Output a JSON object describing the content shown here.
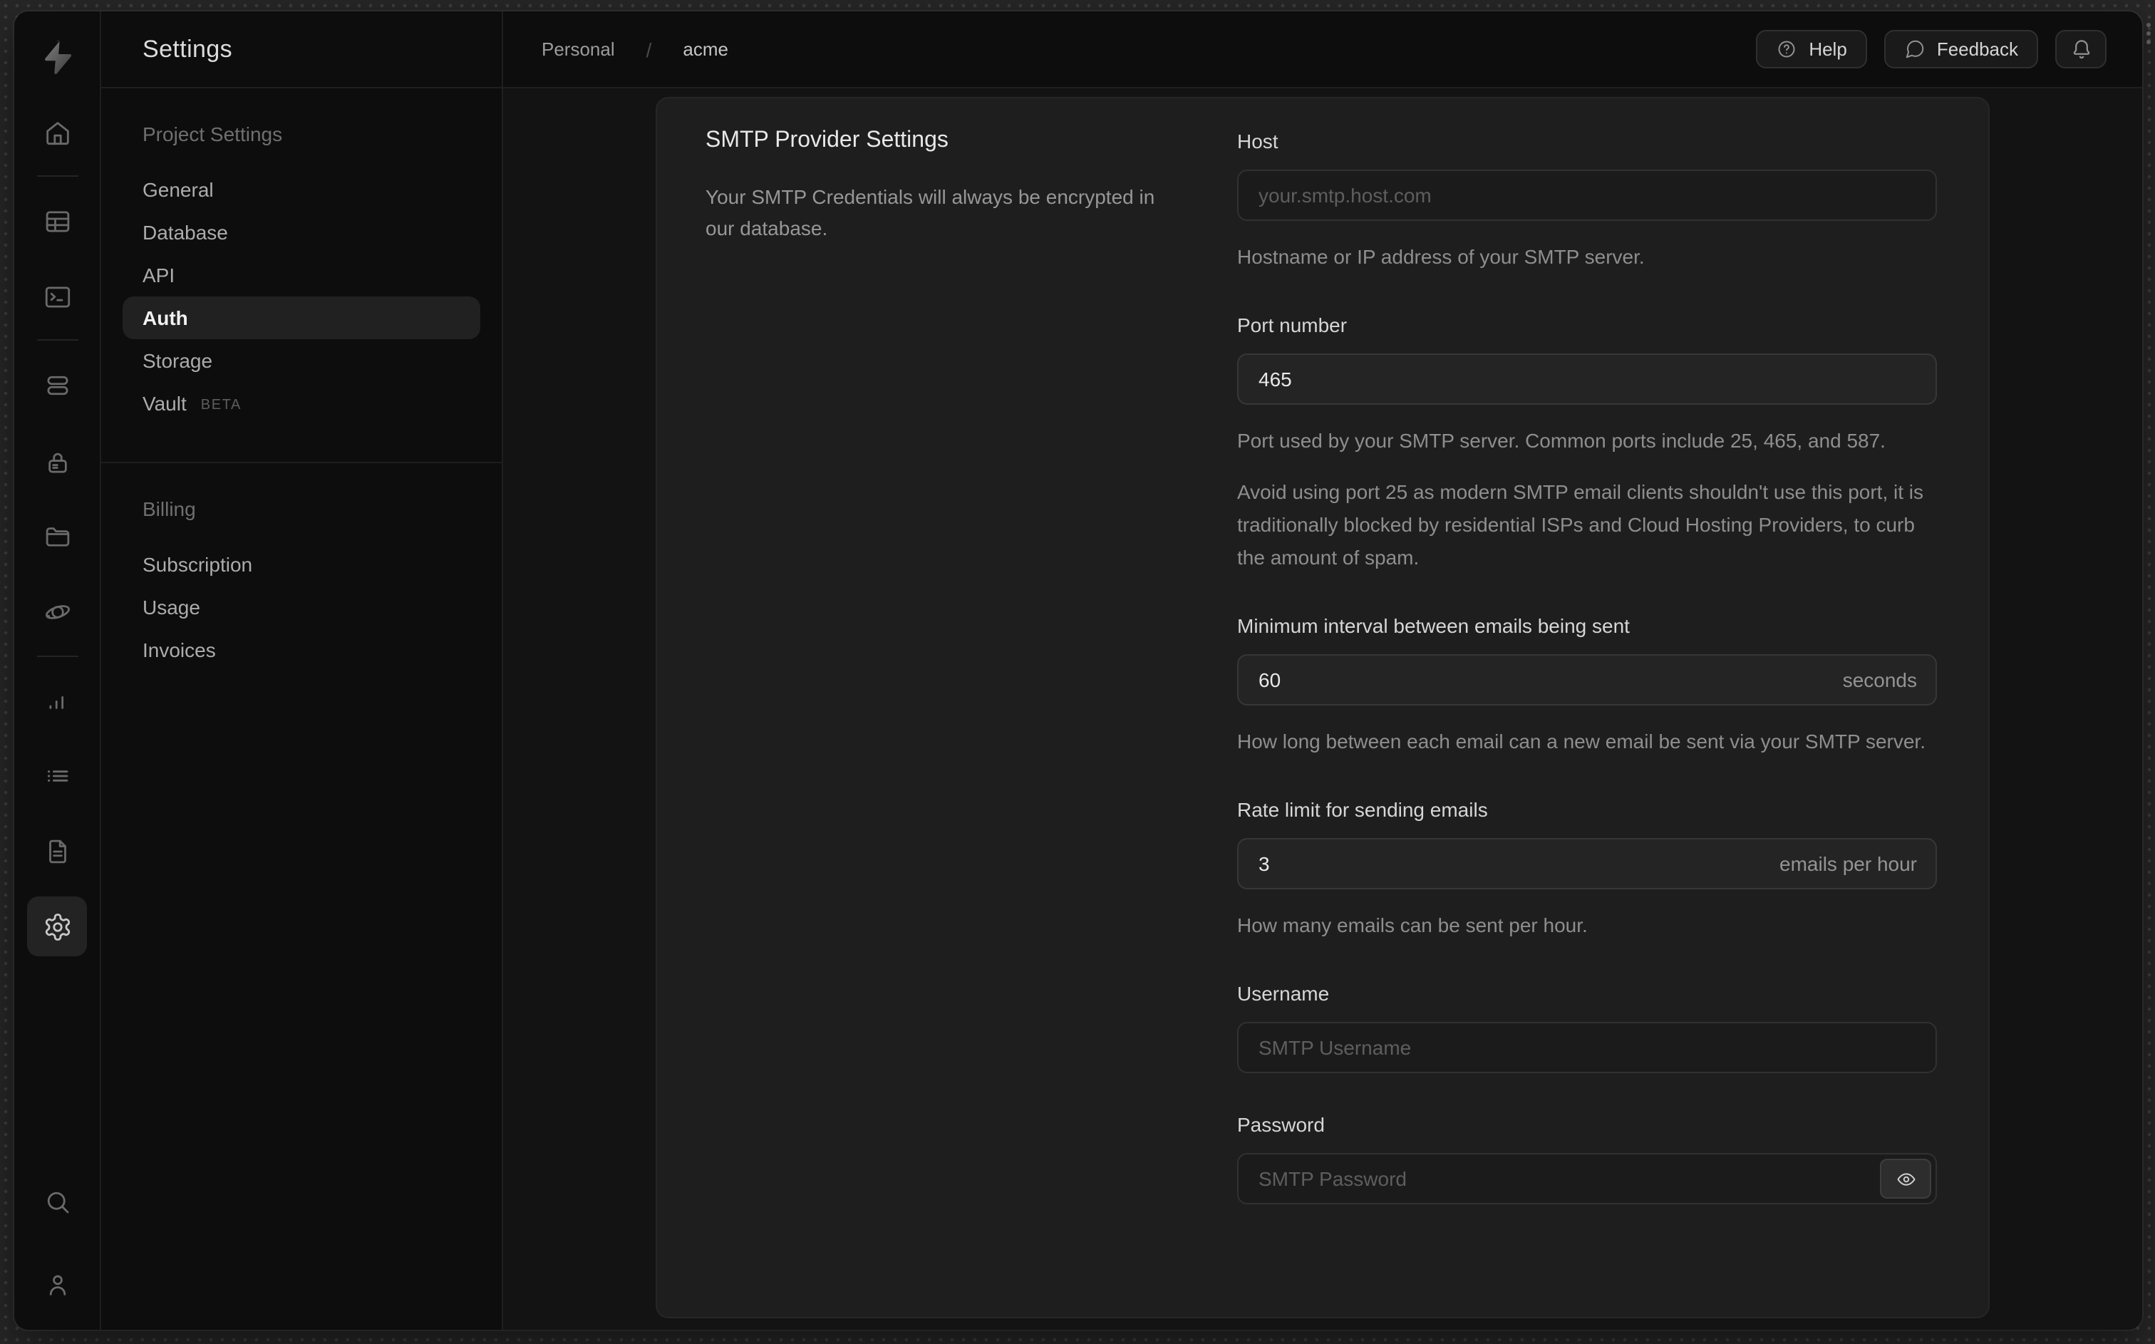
{
  "colors": {
    "outer_bg": "#272727",
    "window_bg": "#0d0d0d",
    "content_bg": "#131313",
    "panel_bg": "#1e1e1e"
  },
  "rail_icons": [
    "supabase-logo",
    "home",
    "table-editor",
    "sql-editor",
    "database",
    "auth-lock",
    "storage-folder",
    "edge-functions-orbit",
    "reports-chart",
    "logs-list",
    "docs-file",
    "settings-gear",
    "search",
    "user"
  ],
  "sidebar": {
    "title": "Settings",
    "sections": [
      {
        "header": "Project Settings",
        "items": [
          {
            "label": "General"
          },
          {
            "label": "Database"
          },
          {
            "label": "API"
          },
          {
            "label": "Auth",
            "active": true
          },
          {
            "label": "Storage"
          },
          {
            "label": "Vault",
            "badge": "BETA"
          }
        ]
      },
      {
        "header": "Billing",
        "items": [
          {
            "label": "Subscription"
          },
          {
            "label": "Usage"
          },
          {
            "label": "Invoices"
          }
        ]
      }
    ]
  },
  "header": {
    "breadcrumb": {
      "org": "Personal",
      "separator": "/",
      "project": "acme"
    },
    "actions": {
      "help": "Help",
      "feedback": "Feedback",
      "notifications_icon": "bell"
    }
  },
  "panel": {
    "title": "SMTP Provider Settings",
    "description": "Your SMTP Credentials will always be encrypted in our database.",
    "fields": {
      "host": {
        "label": "Host",
        "placeholder": "your.smtp.host.com",
        "helper": "Hostname or IP address of your SMTP server."
      },
      "port": {
        "label": "Port number",
        "value": "465",
        "helper": "Port used by your SMTP server. Common ports include 25, 465, and 587.",
        "note": "Avoid using port 25 as modern SMTP email clients shouldn't use this port, it is traditionally blocked by residential ISPs and Cloud Hosting Providers, to curb the amount of spam."
      },
      "interval": {
        "label": "Minimum interval between emails being sent",
        "value": "60",
        "suffix": "seconds",
        "helper": "How long between each email can a new email be sent via your SMTP server."
      },
      "rate": {
        "label": "Rate limit for sending emails",
        "value": "3",
        "suffix": "emails per hour",
        "helper": "How many emails can be sent per hour."
      },
      "username": {
        "label": "Username",
        "placeholder": "SMTP Username"
      },
      "password": {
        "label": "Password",
        "placeholder": "SMTP Password",
        "toggle_icon": "eye"
      }
    }
  }
}
